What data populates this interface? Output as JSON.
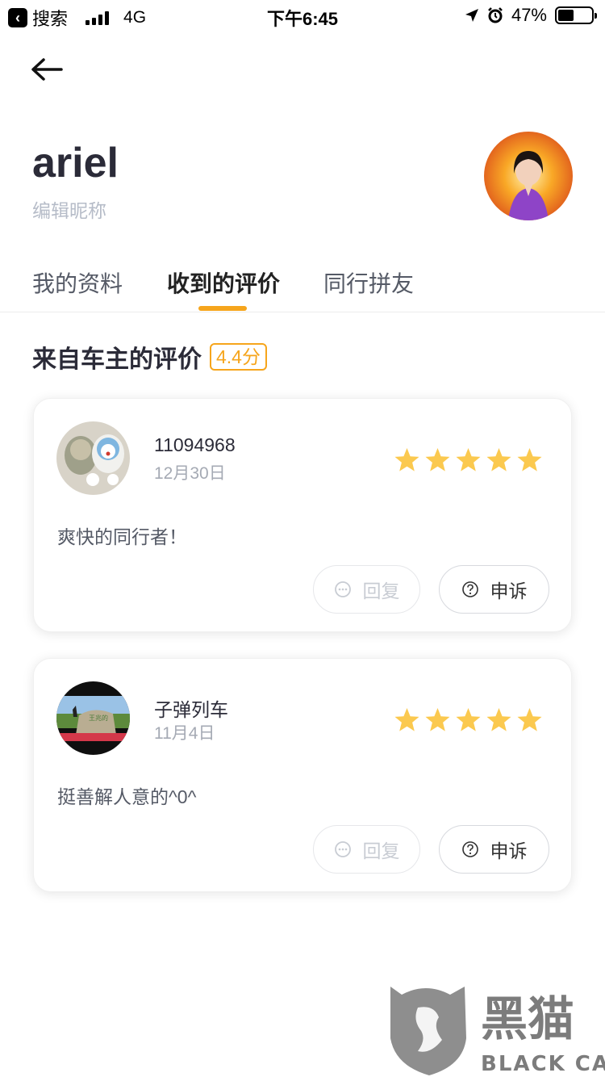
{
  "status_bar": {
    "back_app_label": "搜索",
    "network": "4G",
    "time": "下午6:45",
    "battery_percent": "47%",
    "battery_level": 0.47
  },
  "profile": {
    "username": "ariel",
    "edit_nickname": "编辑昵称"
  },
  "tabs": [
    {
      "label": "我的资料",
      "active": false
    },
    {
      "label": "收到的评价",
      "active": true
    },
    {
      "label": "同行拼友",
      "active": false
    }
  ],
  "section": {
    "title": "来自车主的评价",
    "score": "4.4分"
  },
  "reviews": [
    {
      "name": "11094968",
      "date": "12月30日",
      "stars": 5,
      "comment": "爽快的同行者！",
      "reply_label": "回复",
      "appeal_label": "申诉"
    },
    {
      "name": "子弹列车",
      "date": "11月4日",
      "stars": 5,
      "comment": "挺善解人意的^0^",
      "reply_label": "回复",
      "appeal_label": "申诉"
    }
  ],
  "watermark": {
    "cn": "黑猫",
    "en": "BLACK CAT"
  },
  "colors": {
    "accent": "#f6a51c",
    "star": "#fbc94f",
    "text_dark": "#2b2b38",
    "text_muted": "#a5aab4"
  }
}
